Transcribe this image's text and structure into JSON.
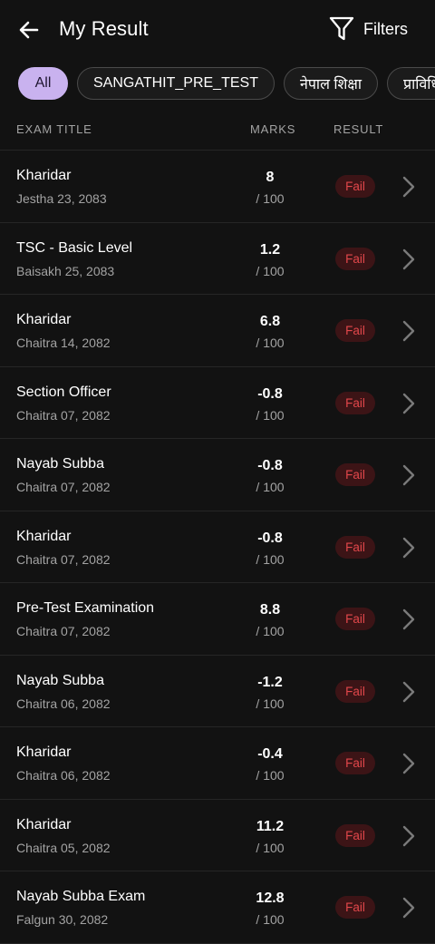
{
  "header": {
    "title": "My Result",
    "filters_label": "Filters"
  },
  "chips": [
    {
      "label": "All",
      "active": true
    },
    {
      "label": "SANGATHIT_PRE_TEST",
      "active": false
    },
    {
      "label": "नेपाल शिक्षा",
      "active": false
    },
    {
      "label": "प्राविधिक",
      "active": false
    }
  ],
  "table": {
    "headers": {
      "title": "EXAM TITLE",
      "marks": "MARKS",
      "result": "RESULT"
    },
    "rows": [
      {
        "name": "Kharidar",
        "date": "Jestha 23, 2083",
        "score": "8",
        "total": "/ 100",
        "result": "Fail"
      },
      {
        "name": "TSC - Basic Level",
        "date": "Baisakh 25, 2083",
        "score": "1.2",
        "total": "/ 100",
        "result": "Fail"
      },
      {
        "name": "Kharidar",
        "date": "Chaitra 14, 2082",
        "score": "6.8",
        "total": "/ 100",
        "result": "Fail"
      },
      {
        "name": "Section Officer",
        "date": "Chaitra 07, 2082",
        "score": "-0.8",
        "total": "/ 100",
        "result": "Fail"
      },
      {
        "name": "Nayab Subba",
        "date": "Chaitra 07, 2082",
        "score": "-0.8",
        "total": "/ 100",
        "result": "Fail"
      },
      {
        "name": "Kharidar",
        "date": "Chaitra 07, 2082",
        "score": "-0.8",
        "total": "/ 100",
        "result": "Fail"
      },
      {
        "name": "Pre-Test Examination",
        "date": "Chaitra 07, 2082",
        "score": "8.8",
        "total": "/ 100",
        "result": "Fail"
      },
      {
        "name": "Nayab Subba",
        "date": "Chaitra 06, 2082",
        "score": "-1.2",
        "total": "/ 100",
        "result": "Fail"
      },
      {
        "name": "Kharidar",
        "date": "Chaitra 06, 2082",
        "score": "-0.4",
        "total": "/ 100",
        "result": "Fail"
      },
      {
        "name": "Kharidar",
        "date": "Chaitra 05, 2082",
        "score": "11.2",
        "total": "/ 100",
        "result": "Fail"
      },
      {
        "name": "Nayab Subba Exam",
        "date": "Falgun 30, 2082",
        "score": "12.8",
        "total": "/ 100",
        "result": "Fail"
      }
    ]
  },
  "colors": {
    "background": "#121212",
    "active_chip": "#c9b2ef",
    "fail_text": "#e2474b",
    "fail_bg": "#3c1416",
    "muted_text": "#a3a3a3"
  },
  "icons": {
    "back": "arrow-left-icon",
    "filter": "funnel-icon",
    "row_action": "chevron-right-icon"
  }
}
